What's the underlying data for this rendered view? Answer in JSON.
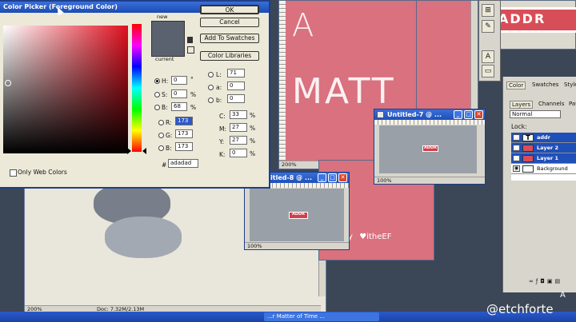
{
  "color_picker": {
    "title": "Color Picker (Foreground Color)",
    "ok": "OK",
    "cancel": "Cancel",
    "add_to_swatches": "Add To Swatches",
    "color_libraries": "Color Libraries",
    "new_label": "new",
    "current_label": "current",
    "only_web_colors": "Only Web Colors",
    "h_label": "H:",
    "h_value": "0",
    "h_unit": "°",
    "s_label": "S:",
    "s_value": "0",
    "s_unit": "%",
    "b_label": "B:",
    "b_value": "68",
    "b_unit": "%",
    "r_label": "R:",
    "r_value": "173",
    "g_label": "G:",
    "g_value": "173",
    "bb_label": "B:",
    "bb_value": "173",
    "l_label": "L:",
    "l_value": "71",
    "a_label": "a:",
    "a_value": "0",
    "lb_label": "b:",
    "lb_value": "0",
    "c_label": "C:",
    "c_value": "33",
    "c_unit": "%",
    "m_label": "M:",
    "m_value": "27",
    "m_unit": "%",
    "y_label": "Y:",
    "y_value": "27",
    "y_unit": "%",
    "k_label": "K:",
    "k_value": "0",
    "k_unit": "%",
    "hex_label": "#",
    "hex_value": "adadad",
    "swatch_color": "#adadad"
  },
  "big_canvas": {
    "letter_a": "A",
    "word": "MATT",
    "zoom": "200%",
    "signature": "y   ♥itheEF"
  },
  "bg_doc": {
    "zoom": "200%",
    "doc_info": "Doc: 7.32M/2.13M"
  },
  "untitled7": {
    "title": "Untitled-7 @ ...",
    "zoom": "100%",
    "tag": "ADDR"
  },
  "untitled8": {
    "title": "Untitled-8 @ ...",
    "zoom": "100%",
    "tag": "ADDR"
  },
  "top_right_doc": {
    "banner": "ADDR"
  },
  "panels": {
    "tabs_top": [
      "Color",
      "Swatches",
      "Styles"
    ],
    "tabs_layers": [
      "Layers",
      "Channels",
      "Paths"
    ],
    "blend_mode": "Normal",
    "lock_label": "Lock:",
    "layers": [
      {
        "name": "addr",
        "type": "text"
      },
      {
        "name": "Layer 2",
        "type": "pixel"
      },
      {
        "name": "Layer 1",
        "type": "pixel"
      },
      {
        "name": "Background",
        "type": "background"
      }
    ]
  },
  "taskbar": {
    "item": "...r Matter of Time ..."
  },
  "corner_label": "A",
  "watermark": "@etchforte",
  "colors": {
    "desktop": "#3b4657",
    "pink": "#d9717f",
    "gray_canvas": "#9aa0a8",
    "selection": "#1f4fb8"
  }
}
